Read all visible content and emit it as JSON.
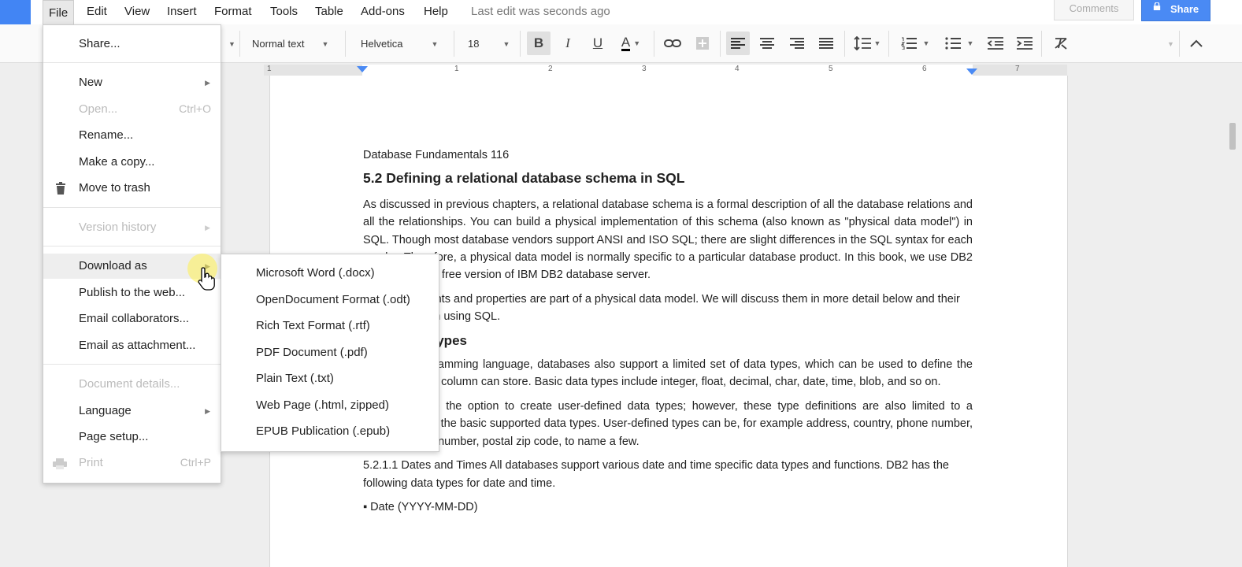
{
  "menubar": {
    "items": [
      "File",
      "Edit",
      "View",
      "Insert",
      "Format",
      "Tools",
      "Table",
      "Add-ons",
      "Help"
    ],
    "last_edit": "Last edit was seconds ago",
    "comments_label": "Comments",
    "share_label": "Share"
  },
  "toolbar": {
    "style": "Normal text",
    "font": "Helvetica",
    "size": "18",
    "icons": [
      "bold-icon",
      "italic-icon",
      "underline-icon",
      "text-color-icon",
      "link-icon",
      "comment-icon",
      "align-left-icon",
      "align-center-icon",
      "align-right-icon",
      "justify-icon",
      "line-spacing-icon",
      "numbered-list-icon",
      "bulleted-list-icon",
      "decrease-indent-icon",
      "increase-indent-icon",
      "clear-formatting-icon",
      "collapse-icon"
    ]
  },
  "ruler": {
    "numbers": [
      "1",
      "1",
      "2",
      "3",
      "4",
      "5",
      "6",
      "7"
    ]
  },
  "file_menu": {
    "items": [
      {
        "label": "Share...",
        "shortcut": "",
        "disabled": false,
        "submenu": false
      },
      {
        "label": "New",
        "shortcut": "",
        "disabled": false,
        "submenu": true
      },
      {
        "label": "Open...",
        "shortcut": "Ctrl+O",
        "disabled": true,
        "submenu": false
      },
      {
        "label": "Rename...",
        "shortcut": "",
        "disabled": false,
        "submenu": false
      },
      {
        "label": "Make a copy...",
        "shortcut": "",
        "disabled": false,
        "submenu": false
      },
      {
        "label": "Move to trash",
        "shortcut": "",
        "disabled": false,
        "submenu": false
      },
      {
        "label": "Version history",
        "shortcut": "",
        "disabled": true,
        "submenu": true
      },
      {
        "label": "Download as",
        "shortcut": "",
        "disabled": false,
        "submenu": true
      },
      {
        "label": "Publish to the web...",
        "shortcut": "",
        "disabled": false,
        "submenu": false
      },
      {
        "label": "Email collaborators...",
        "shortcut": "",
        "disabled": false,
        "submenu": false
      },
      {
        "label": "Email as attachment...",
        "shortcut": "",
        "disabled": false,
        "submenu": false
      },
      {
        "label": "Document details...",
        "shortcut": "",
        "disabled": true,
        "submenu": false
      },
      {
        "label": "Language",
        "shortcut": "",
        "disabled": false,
        "submenu": true
      },
      {
        "label": "Page setup...",
        "shortcut": "",
        "disabled": false,
        "submenu": false
      },
      {
        "label": "Print",
        "shortcut": "Ctrl+P",
        "disabled": true,
        "submenu": false
      }
    ]
  },
  "download_submenu": {
    "items": [
      "Microsoft Word (.docx)",
      "OpenDocument Format (.odt)",
      "Rich Text Format (.rtf)",
      "PDF Document (.pdf)",
      "Plain Text (.txt)",
      "Web Page (.html, zipped)",
      "EPUB Publication (.epub)"
    ]
  },
  "document": {
    "page_header": "Database Fundamentals 116",
    "heading": "5.2 Defining a relational database schema in SQL",
    "p1": "As discussed in previous chapters, a relational database schema is a formal description of all the database relations and all the relationships. You can build a physical implementation of this schema (also known as \"physical data model\") in SQL. Though most database vendors support ANSI and ISO SQL; there are slight differences in the SQL syntax for each vendor. Therefore, a physical data model is normally specific to a particular database product. In this book, we use DB2 Express-C, the free version of IBM DB2 database server.",
    "p2": "Various elements and properties are part of a physical data model. We will discuss them in more detail below and their implementation using SQL.",
    "subheading": "5.2.1 Data Types",
    "p3": "Like any programming language, databases also support a limited set of data types, which can be used to define the types of data a column can store. Basic data types include integer, float, decimal, char, date, time, blob, and so on.",
    "p4": "You also have the option to create user-defined data types; however, these type definitions are also limited to a combination of the basic supported data types. User-defined types can be, for example address, country, phone number, social security number, postal zip code, to name a few.",
    "p5": "5.2.1.1 Dates and Times All databases support various date and time specific data types and functions. DB2 has the following data types for date and time.",
    "bullet1": "▪ Date (YYYY-MM-DD)"
  }
}
